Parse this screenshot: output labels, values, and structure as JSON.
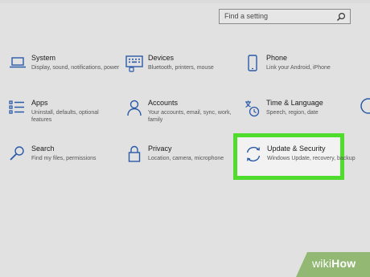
{
  "search": {
    "placeholder": "Find a setting"
  },
  "tiles": [
    {
      "title": "System",
      "desc": "Display, sound, notifications, power"
    },
    {
      "title": "Devices",
      "desc": "Bluetooth, printers, mouse"
    },
    {
      "title": "Phone",
      "desc": "Link your Android, iPhone"
    },
    {
      "title": "Apps",
      "desc": "Uninstall, defaults, optional features"
    },
    {
      "title": "Accounts",
      "desc": "Your accounts, email, sync, work, family"
    },
    {
      "title": "Time & Language",
      "desc": "Speech, region, date"
    },
    {
      "title": "Search",
      "desc": "Find my files, permissions"
    },
    {
      "title": "Privacy",
      "desc": "Location, camera, microphone"
    },
    {
      "title": "Update & Security",
      "desc": "Windows Update, recovery, backup"
    }
  ],
  "watermark": {
    "part1": "wiki",
    "part2": "How"
  },
  "colors": {
    "accent": "#2b5aa8",
    "highlight": "#4fdc2c"
  }
}
